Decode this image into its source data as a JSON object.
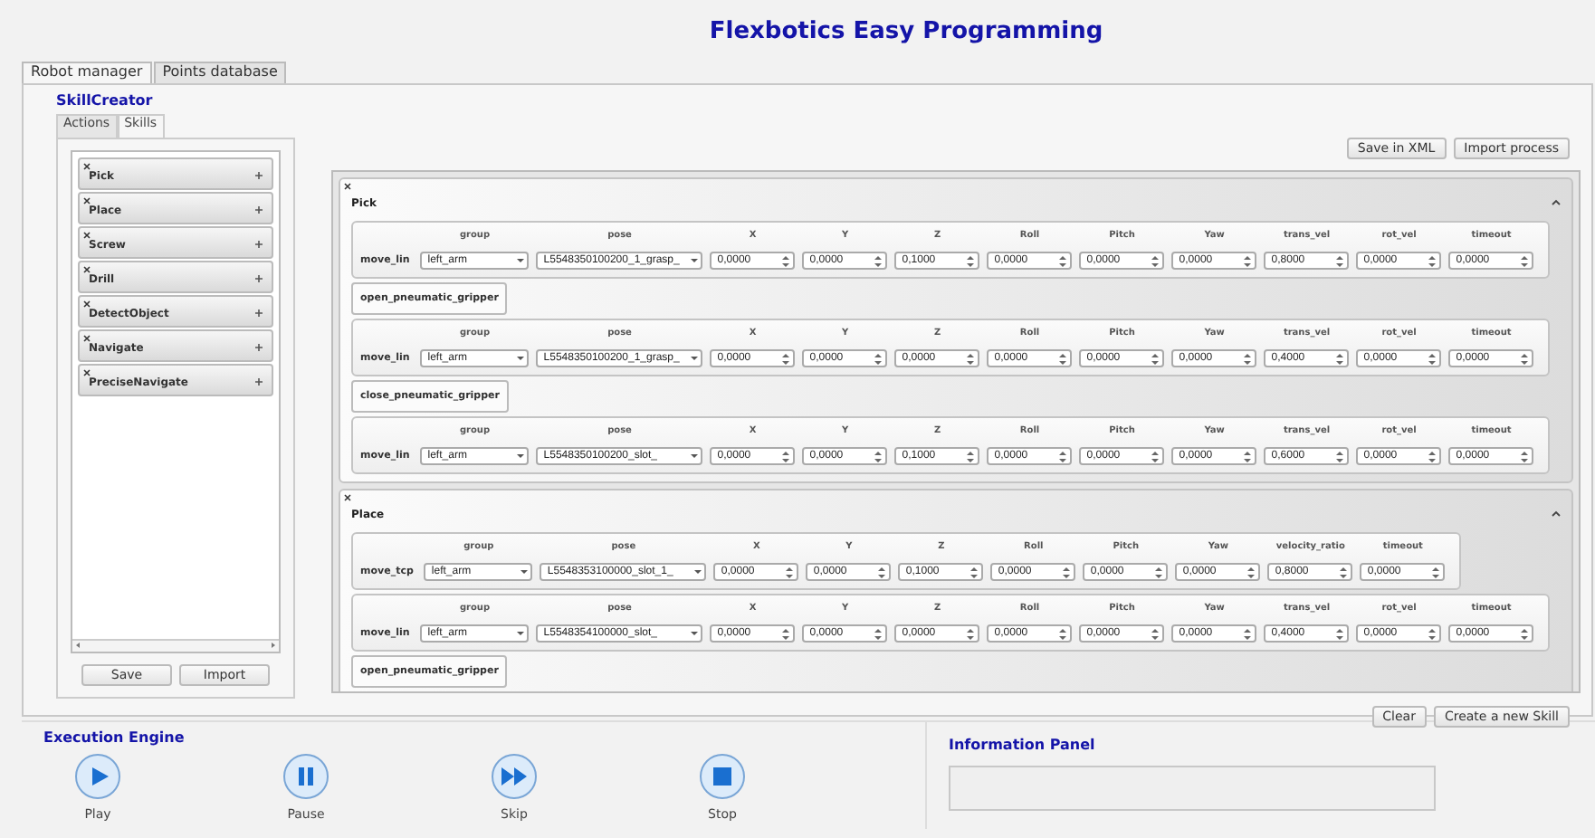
{
  "title": "Flexbotics Easy Programming",
  "tabs": [
    {
      "label": "Robot manager",
      "selected": true
    },
    {
      "label": "Points database",
      "selected": false
    }
  ],
  "section_title": "SkillCreator",
  "sub_tabs": [
    {
      "label": "Actions",
      "selected": false
    },
    {
      "label": "Skills",
      "selected": true
    }
  ],
  "skill_list": [
    {
      "label": "Pick"
    },
    {
      "label": "Place"
    },
    {
      "label": "Screw"
    },
    {
      "label": "Drill"
    },
    {
      "label": "DetectObject"
    },
    {
      "label": "Navigate"
    },
    {
      "label": "PreciseNavigate"
    }
  ],
  "list_buttons": [
    "Save",
    "Import"
  ],
  "top_buttons": [
    "Save in XML",
    "Import process"
  ],
  "skills": [
    {
      "name": "Pick",
      "actions": [
        {
          "kind": "motion",
          "type": "move_lin",
          "fields": [
            {
              "label": "group",
              "value": "left_arm",
              "kind": "combo"
            },
            {
              "label": "pose",
              "value": "L5548350100200_1_grasp_",
              "kind": "combo"
            },
            {
              "label": "X",
              "value": "0,0000",
              "kind": "spin"
            },
            {
              "label": "Y",
              "value": "0,0000",
              "kind": "spin"
            },
            {
              "label": "Z",
              "value": "0,1000",
              "kind": "spin"
            },
            {
              "label": "Roll",
              "value": "0,0000",
              "kind": "spin"
            },
            {
              "label": "Pitch",
              "value": "0,0000",
              "kind": "spin"
            },
            {
              "label": "Yaw",
              "value": "0,0000",
              "kind": "spin"
            },
            {
              "label": "trans_vel",
              "value": "0,8000",
              "kind": "spin"
            },
            {
              "label": "rot_vel",
              "value": "0,0000",
              "kind": "spin"
            },
            {
              "label": "timeout",
              "value": "0,0000",
              "kind": "spin"
            }
          ]
        },
        {
          "kind": "command",
          "type": "open_pneumatic_gripper"
        },
        {
          "kind": "motion",
          "type": "move_lin",
          "fields": [
            {
              "label": "group",
              "value": "left_arm",
              "kind": "combo"
            },
            {
              "label": "pose",
              "value": "L5548350100200_1_grasp_",
              "kind": "combo"
            },
            {
              "label": "X",
              "value": "0,0000",
              "kind": "spin"
            },
            {
              "label": "Y",
              "value": "0,0000",
              "kind": "spin"
            },
            {
              "label": "Z",
              "value": "0,0000",
              "kind": "spin"
            },
            {
              "label": "Roll",
              "value": "0,0000",
              "kind": "spin"
            },
            {
              "label": "Pitch",
              "value": "0,0000",
              "kind": "spin"
            },
            {
              "label": "Yaw",
              "value": "0,0000",
              "kind": "spin"
            },
            {
              "label": "trans_vel",
              "value": "0,4000",
              "kind": "spin"
            },
            {
              "label": "rot_vel",
              "value": "0,0000",
              "kind": "spin"
            },
            {
              "label": "timeout",
              "value": "0,0000",
              "kind": "spin"
            }
          ]
        },
        {
          "kind": "command",
          "type": "close_pneumatic_gripper"
        },
        {
          "kind": "motion",
          "type": "move_lin",
          "fields": [
            {
              "label": "group",
              "value": "left_arm",
              "kind": "combo"
            },
            {
              "label": "pose",
              "value": "L5548350100200_slot_",
              "kind": "combo"
            },
            {
              "label": "X",
              "value": "0,0000",
              "kind": "spin"
            },
            {
              "label": "Y",
              "value": "0,0000",
              "kind": "spin"
            },
            {
              "label": "Z",
              "value": "0,1000",
              "kind": "spin"
            },
            {
              "label": "Roll",
              "value": "0,0000",
              "kind": "spin"
            },
            {
              "label": "Pitch",
              "value": "0,0000",
              "kind": "spin"
            },
            {
              "label": "Yaw",
              "value": "0,0000",
              "kind": "spin"
            },
            {
              "label": "trans_vel",
              "value": "0,6000",
              "kind": "spin"
            },
            {
              "label": "rot_vel",
              "value": "0,0000",
              "kind": "spin"
            },
            {
              "label": "timeout",
              "value": "0,0000",
              "kind": "spin"
            }
          ]
        }
      ]
    },
    {
      "name": "Place",
      "actions": [
        {
          "kind": "motion",
          "type": "move_tcp",
          "fields": [
            {
              "label": "group",
              "value": "left_arm",
              "kind": "combo"
            },
            {
              "label": "pose",
              "value": "L5548353100000_slot_1_",
              "kind": "combo"
            },
            {
              "label": "X",
              "value": "0,0000",
              "kind": "spin"
            },
            {
              "label": "Y",
              "value": "0,0000",
              "kind": "spin"
            },
            {
              "label": "Z",
              "value": "0,1000",
              "kind": "spin"
            },
            {
              "label": "Roll",
              "value": "0,0000",
              "kind": "spin"
            },
            {
              "label": "Pitch",
              "value": "0,0000",
              "kind": "spin"
            },
            {
              "label": "Yaw",
              "value": "0,0000",
              "kind": "spin"
            },
            {
              "label": "velocity_ratio",
              "value": "0,8000",
              "kind": "spin"
            },
            {
              "label": "timeout",
              "value": "0,0000",
              "kind": "spin"
            }
          ]
        },
        {
          "kind": "motion",
          "type": "move_lin",
          "fields": [
            {
              "label": "group",
              "value": "left_arm",
              "kind": "combo"
            },
            {
              "label": "pose",
              "value": "L5548354100000_slot_",
              "kind": "combo"
            },
            {
              "label": "X",
              "value": "0,0000",
              "kind": "spin"
            },
            {
              "label": "Y",
              "value": "0,0000",
              "kind": "spin"
            },
            {
              "label": "Z",
              "value": "0,0000",
              "kind": "spin"
            },
            {
              "label": "Roll",
              "value": "0,0000",
              "kind": "spin"
            },
            {
              "label": "Pitch",
              "value": "0,0000",
              "kind": "spin"
            },
            {
              "label": "Yaw",
              "value": "0,0000",
              "kind": "spin"
            },
            {
              "label": "trans_vel",
              "value": "0,4000",
              "kind": "spin"
            },
            {
              "label": "rot_vel",
              "value": "0,0000",
              "kind": "spin"
            },
            {
              "label": "timeout",
              "value": "0,0000",
              "kind": "spin"
            }
          ]
        },
        {
          "kind": "command",
          "type": "open_pneumatic_gripper"
        }
      ]
    }
  ],
  "bottom_buttons": [
    "Clear",
    "Create a new Skill"
  ],
  "execution": {
    "title": "Execution Engine",
    "controls": [
      {
        "kind": "play",
        "label": "Play"
      },
      {
        "kind": "pause",
        "label": "Pause"
      },
      {
        "kind": "skip",
        "label": "Skip"
      },
      {
        "kind": "stop",
        "label": "Stop"
      }
    ]
  },
  "info_panel": {
    "title": "Information Panel"
  }
}
